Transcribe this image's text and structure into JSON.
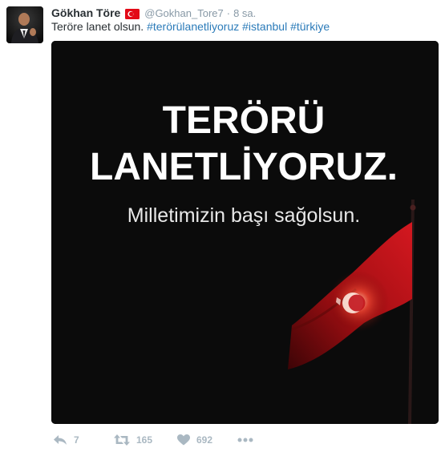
{
  "user": {
    "name": "Gökhan Töre",
    "handle": "@Gokhan_Tore7",
    "separator": "·",
    "time": "8 sa."
  },
  "tweet": {
    "text_plain": "Teröre lanet olsun.",
    "hashtags": [
      "#terörülanetliyoruz",
      "#istanbul",
      "#türkiye"
    ]
  },
  "image": {
    "line1": "TERÖRÜ",
    "line2": "LANETLİYORUZ.",
    "line3": "Milletimizin başı sağolsun."
  },
  "actions": {
    "reply_count": "7",
    "retweet_count": "165",
    "like_count": "692"
  },
  "colors": {
    "link": "#2b7bb9",
    "muted": "#8899a6",
    "action": "#aab8c2",
    "flag": "#e30a17"
  },
  "icons": [
    "flag-icon",
    "reply-icon",
    "retweet-icon",
    "heart-icon",
    "more-icon"
  ]
}
